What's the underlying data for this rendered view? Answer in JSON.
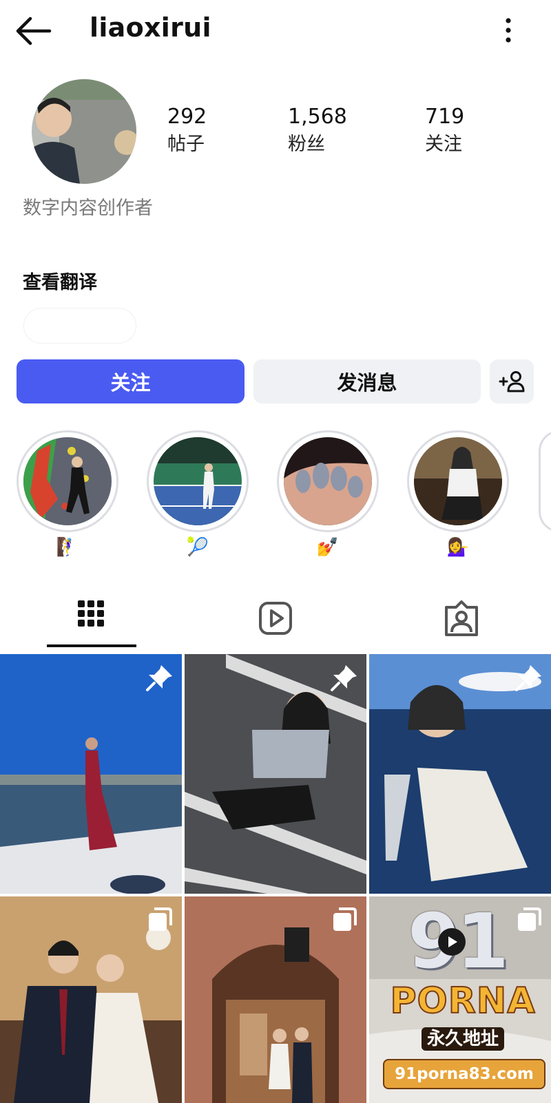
{
  "header": {
    "username": "liaoxirui"
  },
  "stats": [
    {
      "value": "292",
      "label": "帖子"
    },
    {
      "value": "1,568",
      "label": "粉丝"
    },
    {
      "value": "719",
      "label": "关注"
    }
  ],
  "bio": {
    "category": "数字内容创作者",
    "translate": "查看翻译"
  },
  "actions": {
    "follow": "关注",
    "message": "发消息"
  },
  "highlights": [
    {
      "label": "🧗‍♀️"
    },
    {
      "label": "🎾"
    },
    {
      "label": "💅"
    },
    {
      "label": "💁‍♀️"
    }
  ],
  "watermark": {
    "brand_top": "91",
    "brand_name": "PORNA",
    "tagline": "永久地址",
    "url": "91porna83.com"
  },
  "colors": {
    "accent": "#4a5bf2",
    "button_gray": "#eff1f5"
  }
}
